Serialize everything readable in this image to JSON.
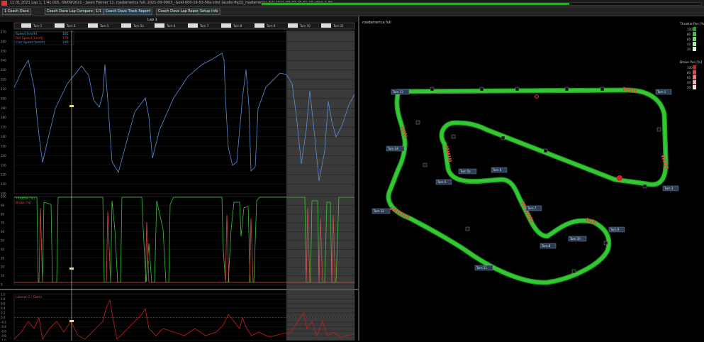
{
  "window": {
    "title": "11.01.2021 Lap 1, 1:41.015, 09/09/2021 - Jason Fenner 12, roadamerica full, 2021-09-0903_-Gold-000-19-53-56a-stint [audio-fhp1]_roadamerica full 2021-09-09 19-01-10_stint_1.ibt",
    "progress_fraction": 0.7
  },
  "toolbar": {
    "buttons": [
      {
        "label": "1 Coach Dave",
        "active": false
      },
      {
        "label": "Coach Dave Lap Compare",
        "active": false
      },
      {
        "label": "1/1",
        "active": false
      },
      {
        "label": "Coach Dave Track Report",
        "active": true
      },
      {
        "label": "Coach Dave Lap Report",
        "active": false
      },
      {
        "label": "Setup Info",
        "active": false
      }
    ]
  },
  "left": {
    "lap_label": "Lap 1",
    "turn_markers": [
      "Turn 1",
      "Turn 3",
      "Turn 5",
      "Turn 5a",
      "Turn 6",
      "Turn 7",
      "Turn 8",
      "Turn 9",
      "Turn 10",
      "Turn 11"
    ],
    "speed_chart": {
      "legend": [
        {
          "name": "Speed [km/h]",
          "value": "185",
          "color": "#4aa7e0"
        },
        {
          "name": "Ref Speed [km/h]",
          "value": "179",
          "color": "#d84b4b"
        },
        {
          "name": "Corr Speed [km/h]",
          "value": "190",
          "color": "#5a8fd8"
        }
      ],
      "ylim": [
        100,
        270
      ],
      "yticks": [
        100,
        110,
        120,
        130,
        140,
        150,
        160,
        170,
        180,
        190,
        200,
        210,
        220,
        230,
        240,
        250,
        260,
        270
      ]
    },
    "throttle_chart": {
      "legend": [
        {
          "name": "Throttle [%]",
          "color": "#3cc43c"
        },
        {
          "name": "Brake [%]",
          "color": "#d84b4b"
        }
      ],
      "ylim": [
        0,
        100
      ],
      "yticks": [
        0,
        10,
        20,
        30,
        40,
        50,
        60,
        70,
        80,
        90,
        100
      ]
    },
    "delta_chart": {
      "legend": [
        {
          "name": "Lateral G / Delta",
          "color": "#d84b4b"
        }
      ],
      "ylim": [
        -1.0,
        1.0
      ],
      "yticks": [
        "-1.0",
        "-0.8",
        "-0.6",
        "-0.4",
        "-0.2",
        "0.0",
        "0.2",
        "0.4",
        "0.6",
        "0.8",
        "1.0"
      ]
    }
  },
  "right": {
    "track_name": "roadamerica full",
    "throttle_legend": {
      "title": "Throttle Pos [%]",
      "items": [
        "100",
        "80",
        "60",
        "40",
        "20"
      ],
      "colors": [
        "#1ea11e",
        "#3cc43c",
        "#6fd86f",
        "#a9eaa9",
        "#dff7df"
      ]
    },
    "brake_legend": {
      "title": "Brake Pos [%]",
      "items": [
        "100",
        "80",
        "60",
        "40",
        "20"
      ],
      "colors": [
        "#c81e1e",
        "#e04848",
        "#ec7878",
        "#f3a8a8",
        "#fbdada"
      ]
    },
    "corners": [
      {
        "label": "Turn 1"
      },
      {
        "label": "Turn 3"
      },
      {
        "label": "Turn 5"
      },
      {
        "label": "Turn 5a"
      },
      {
        "label": "Turn 6"
      },
      {
        "label": "Turn 7"
      },
      {
        "label": "Turn 8"
      },
      {
        "label": "Turn 9"
      },
      {
        "label": "Turn 10"
      },
      {
        "label": "Turn 11"
      },
      {
        "label": "Turn 12"
      },
      {
        "label": "Turn 13"
      },
      {
        "label": "Turn 14"
      }
    ]
  }
}
